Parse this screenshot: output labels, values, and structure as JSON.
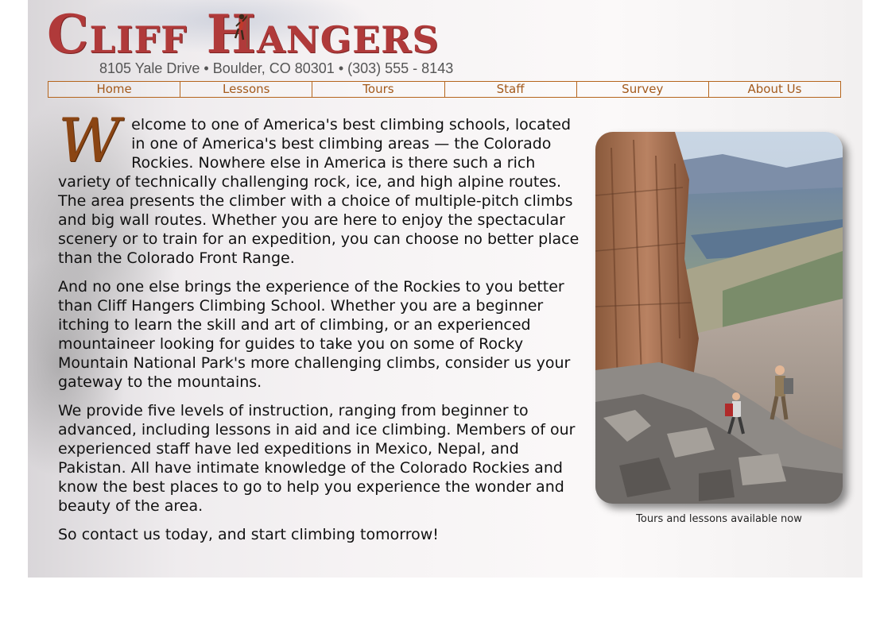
{
  "header": {
    "logo_text": "Cliff Hangers",
    "address": "8105 Yale Drive • Boulder, CO 80301 • (303) 555 - 8143"
  },
  "nav": {
    "items": [
      {
        "label": "Home"
      },
      {
        "label": "Lessons"
      },
      {
        "label": "Tours"
      },
      {
        "label": "Staff"
      },
      {
        "label": "Survey"
      },
      {
        "label": "About Us"
      }
    ]
  },
  "main": {
    "drop_cap": "W",
    "paragraphs": [
      "elcome to one of America's best climbing schools, located in one of America's best climbing areas — the Colorado Rockies. Nowhere else in America is there such a rich variety of technically challenging rock, ice, and high alpine routes. The area presents the climber with a choice of multiple-pitch climbs and big wall routes. Whether you are here to enjoy the spectacular scenery or to train for an expedition, you can choose no better place than the Colorado Front Range.",
      "And no one else brings the experience of the Rockies to you better than Cliff Hangers Climbing School. Whether you are a beginner itching to learn the skill and art of climbing, or an experienced mountaineer looking for guides to take you on some of Rocky Mountain National Park's more challenging climbs, consider us your gateway to the mountains.",
      "We provide five levels of instruction, ranging from beginner to advanced, including lessons in aid and ice climbing. Members of our experienced staff have led expeditions in Mexico, Nepal, and Pakistan. All have intimate knowledge of the Colorado Rockies and know the best places to go to help you experience the wonder and beauty of the area.",
      "So contact us today, and start climbing tomorrow!"
    ]
  },
  "photo": {
    "caption": "Tours and lessons available now"
  },
  "colors": {
    "brand_red": "#b03a3a",
    "nav_orange": "#b5651d",
    "drop_cap_brown": "#8b4513"
  }
}
